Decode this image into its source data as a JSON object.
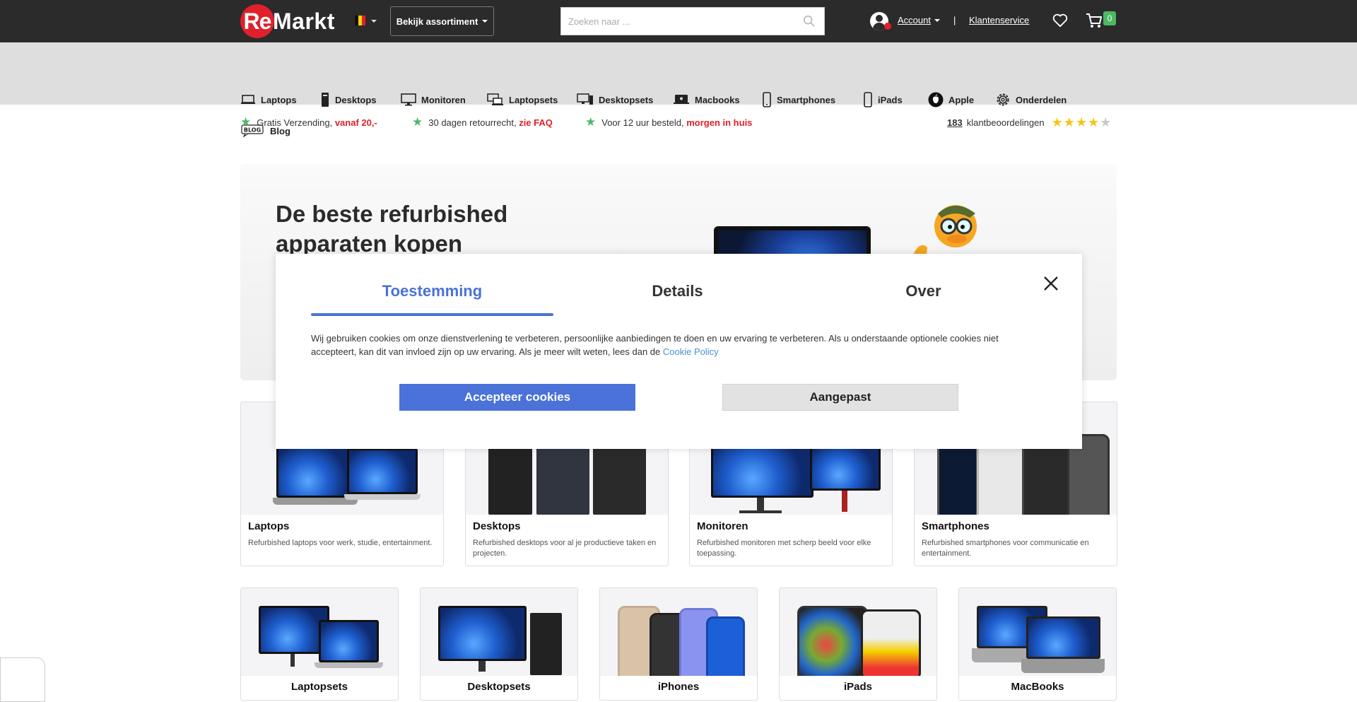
{
  "header": {
    "logo_initials": "Re",
    "logo_rest": "Markt",
    "assortment_label": "Bekijk assortiment",
    "search_placeholder": "Zoeken naar ...",
    "account_label": "Account",
    "separator": "|",
    "service_label": "Klantenservice",
    "cart_count": "0"
  },
  "nav": {
    "items": [
      {
        "label": "Laptops",
        "icon": "laptop-icon"
      },
      {
        "label": "Desktops",
        "icon": "desktop-tower-icon"
      },
      {
        "label": "Monitoren",
        "icon": "monitor-icon"
      },
      {
        "label": "Laptopsets",
        "icon": "laptopset-icon"
      },
      {
        "label": "Desktopsets",
        "icon": "desktopset-icon"
      },
      {
        "label": "Macbooks",
        "icon": "macbook-icon"
      },
      {
        "label": "Smartphones",
        "icon": "smartphone-icon"
      },
      {
        "label": "iPads",
        "icon": "tablet-icon"
      },
      {
        "label": "Apple",
        "icon": "apple-icon"
      },
      {
        "label": "Onderdelen",
        "icon": "gear-icon"
      },
      {
        "label": "Blog",
        "icon": "blog-icon"
      }
    ]
  },
  "usp": {
    "shipping_text": "Gratis Verzending,",
    "shipping_highlight": "vanaf 20,-",
    "returns_text": "30 dagen retourrecht,",
    "returns_highlight": "zie FAQ",
    "delivery_text": "Voor 12 uur besteld,",
    "delivery_highlight": "morgen in huis",
    "review_count": "183",
    "review_label": "klantbeoordelingen",
    "rating_stars": 4
  },
  "hero": {
    "title_line1": "De beste refurbished",
    "title_line2": "apparaten kopen"
  },
  "cards": [
    {
      "title": "Laptops",
      "desc": "Refurbished laptops voor werk, studie, entertainment."
    },
    {
      "title": "Desktops",
      "desc": "Refurbished desktops voor al je productieve taken en projecten."
    },
    {
      "title": "Monitoren",
      "desc": "Refurbished monitoren met scherp beeld voor elke toepassing."
    },
    {
      "title": "Smartphones",
      "desc": "Refurbished smartphones voor communicatie en entertainment."
    }
  ],
  "small_cards": [
    {
      "title": "Laptopsets"
    },
    {
      "title": "Desktopsets"
    },
    {
      "title": "iPhones"
    },
    {
      "title": "iPads"
    },
    {
      "title": "MacBooks"
    }
  ],
  "cookie_modal": {
    "tabs": [
      "Toestemming",
      "Details",
      "Over"
    ],
    "active_tab": "Toestemming",
    "text": "Wij gebruiken cookies om onze dienstverlening te verbeteren, persoonlijke aanbiedingen te doen en uw ervaring te verbeteren. Als u onderstaande optionele cookies niet accepteert, kan dit van invloed zijn op uw ervaring. Als je meer wilt weten, lees dan de",
    "link_text": "Cookie Policy",
    "accept_label": "Accepteer cookies",
    "custom_label": "Aangepast"
  },
  "colors": {
    "brand_red": "#e0202a",
    "accent_blue": "#4a72d8",
    "usp_green": "#4cb963",
    "topbar": "#2b2b2b"
  }
}
